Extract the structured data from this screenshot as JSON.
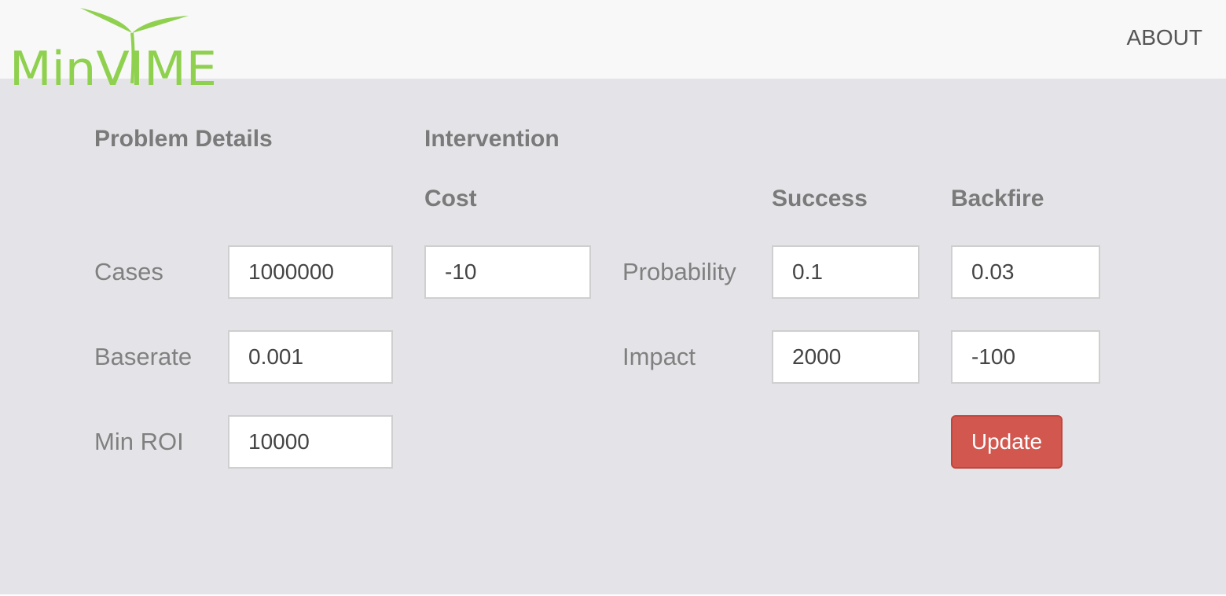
{
  "brand": {
    "logo_text": "MinVIME",
    "logo_color": "#8fd14f"
  },
  "nav": {
    "about_label": "ABOUT"
  },
  "sections": {
    "problem_details": "Problem Details",
    "intervention": "Intervention",
    "cost": "Cost",
    "success": "Success",
    "backfire": "Backfire"
  },
  "problem": {
    "cases_label": "Cases",
    "cases_value": "1000000",
    "baserate_label": "Baserate",
    "baserate_value": "0.001",
    "min_roi_label": "Min ROI",
    "min_roi_value": "10000"
  },
  "intervention": {
    "cost_value": "-10",
    "probability_label": "Probability",
    "impact_label": "Impact",
    "success_probability": "0.1",
    "success_impact": "2000",
    "backfire_probability": "0.03",
    "backfire_impact": "-100"
  },
  "actions": {
    "update_label": "Update",
    "update_color": "#d2574e"
  }
}
